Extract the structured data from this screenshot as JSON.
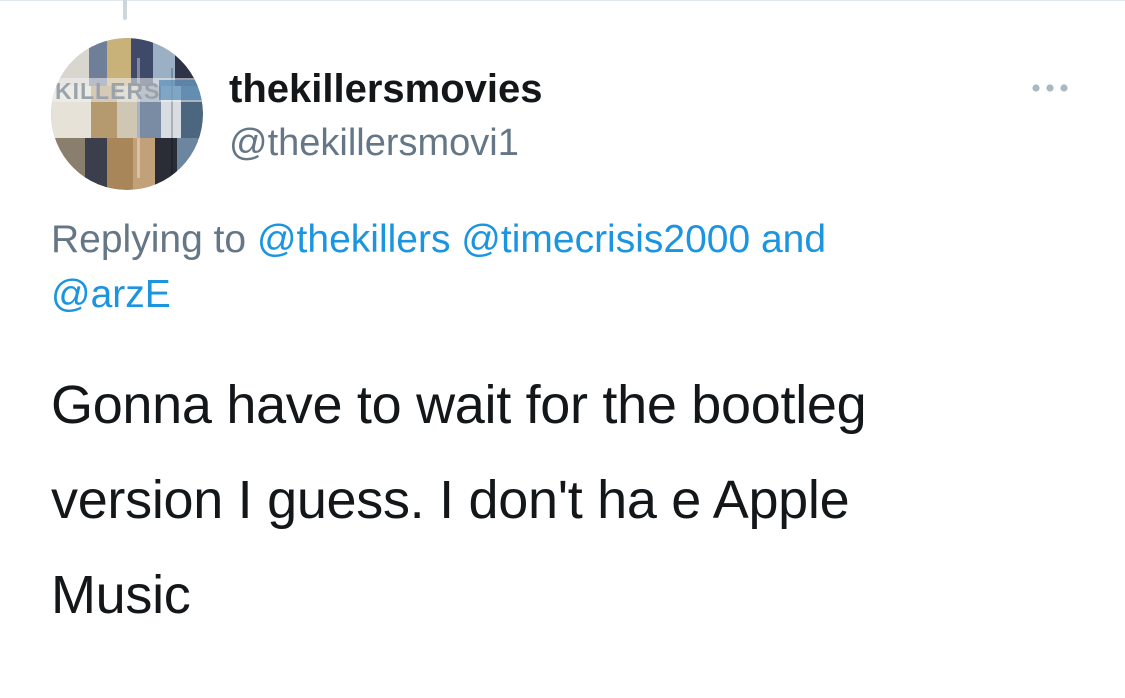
{
  "tweet": {
    "author": {
      "display_name": "thekillersmovies",
      "handle": "@thekillersmovi1",
      "avatar_icon": "album-collage-avatar",
      "avatar_logo_text": "KILLERS"
    },
    "more_icon": "more-horizontal-icon",
    "replying": {
      "prefix": "Replying to",
      "mentions": [
        "@thekillers",
        "@timecrisis2000"
      ],
      "joiner": "and",
      "last_mention": "@arzE"
    },
    "text_lines": [
      "Gonna have to wait for the bootleg",
      "version I guess. I don't ha e Apple",
      "Music"
    ]
  },
  "colors": {
    "primary_text": "#14171a",
    "secondary_text": "#657786",
    "link": "#1b95e0",
    "divider": "#e1e8ed",
    "thread_line": "#cdd6dc",
    "background": "#ffffff"
  }
}
